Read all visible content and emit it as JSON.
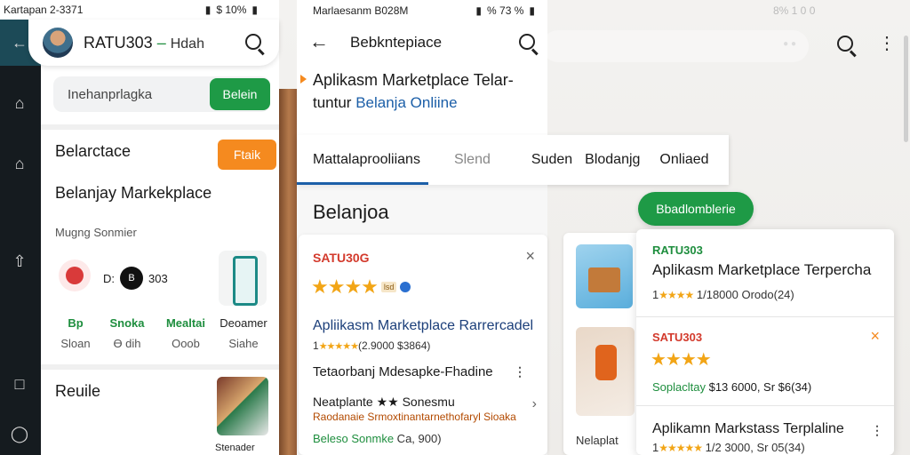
{
  "strip": {
    "back_icon": "back-arrow-icon",
    "icons": [
      "home-icon",
      "house-icon",
      "share-icon",
      "message-icon",
      "power-icon"
    ]
  },
  "screen1": {
    "status": {
      "left": "Kartapan 2-3371",
      "right": "$ 10%"
    },
    "app_title_brand": "RATU303",
    "app_title_sep": " – ",
    "app_title_sub": "Hdah",
    "search": {
      "placeholder": "Inehanprlagka",
      "button": "Belein"
    },
    "section1": {
      "title": "Belarctace",
      "action": "Ftaik"
    },
    "section2": {
      "title": "Belanjay Markekplace"
    },
    "note": "Mugng Sonmier",
    "feature": {
      "prefix": "D:",
      "badge": "B",
      "value": "303"
    },
    "columns": [
      {
        "top": "Bp",
        "bottom": "Sloan",
        "green": true
      },
      {
        "top": "Snoka",
        "bottom": "Ɵ dih",
        "green": true
      },
      {
        "top": "Mealtai",
        "bottom": "Ooob",
        "green": true
      },
      {
        "top": "Deoamer",
        "bottom": "Siahe",
        "green": false
      }
    ],
    "footer_title": "Reuile",
    "thumb_caption": "Stenader"
  },
  "screen2": {
    "status": {
      "left": "Marlaesanm B028M",
      "right": "% 73 %"
    },
    "app_title": "Bebkntepiace",
    "hero_line1": "Aplikasm Marketplace Telar-",
    "hero_line2_prefix": "tuntur ",
    "hero_line2_accent": "Belanja Onliine",
    "tabs": [
      "Mattalaprooliians",
      "Slend",
      "Suden",
      "Blodanjg",
      "Onliaed"
    ],
    "section_title": "Belanjoa",
    "card": {
      "brand": "SATU30G",
      "close": "×",
      "stars": "★★★★",
      "tag": "lsd",
      "title": "Apliikasm Marketplace Rarrercadel",
      "rating_stars": "★★★★★",
      "rating_prefix": "1",
      "rating_text": "(2.9000 $3864)",
      "row1": "Tetaorbanj Mdesapke-Fhadine",
      "row2": "Neatplante ★★ Sonesmu",
      "row3": "Raodanaie Srmoxtinantarnethofaryl Sioaka",
      "row4_green": "Beleso Sonmke",
      "row4_dark": " Ca, 900)"
    },
    "middle_caption": "Nelaplat"
  },
  "background": {
    "status": "8% 1 0 0"
  },
  "pill": "Bbadlomblerie",
  "screen3": {
    "brand1": "RATU303",
    "title1": "Aplikasm Marketplace Terpercha",
    "rating1_prefix": "1",
    "rating1_stars": "★★★★",
    "rating1_text": " 1/18000 Orodo(24)",
    "brand2": "SATU303",
    "close2": "×",
    "stars2": "★★★★",
    "rating2_green": "Soplacltay",
    "rating2_text": " $13 6000, Sr $6(34)",
    "title3": "Aplikamn Markstass Terplaline",
    "rating3_prefix": "1",
    "rating3_stars": "★★★★★",
    "rating3_text": " 1/2 3000, Sr 05(34)"
  },
  "colors": {
    "green": "#1e9a46",
    "orange": "#f58a1f",
    "red": "#d33a2c",
    "blue": "#1c5fa8"
  }
}
